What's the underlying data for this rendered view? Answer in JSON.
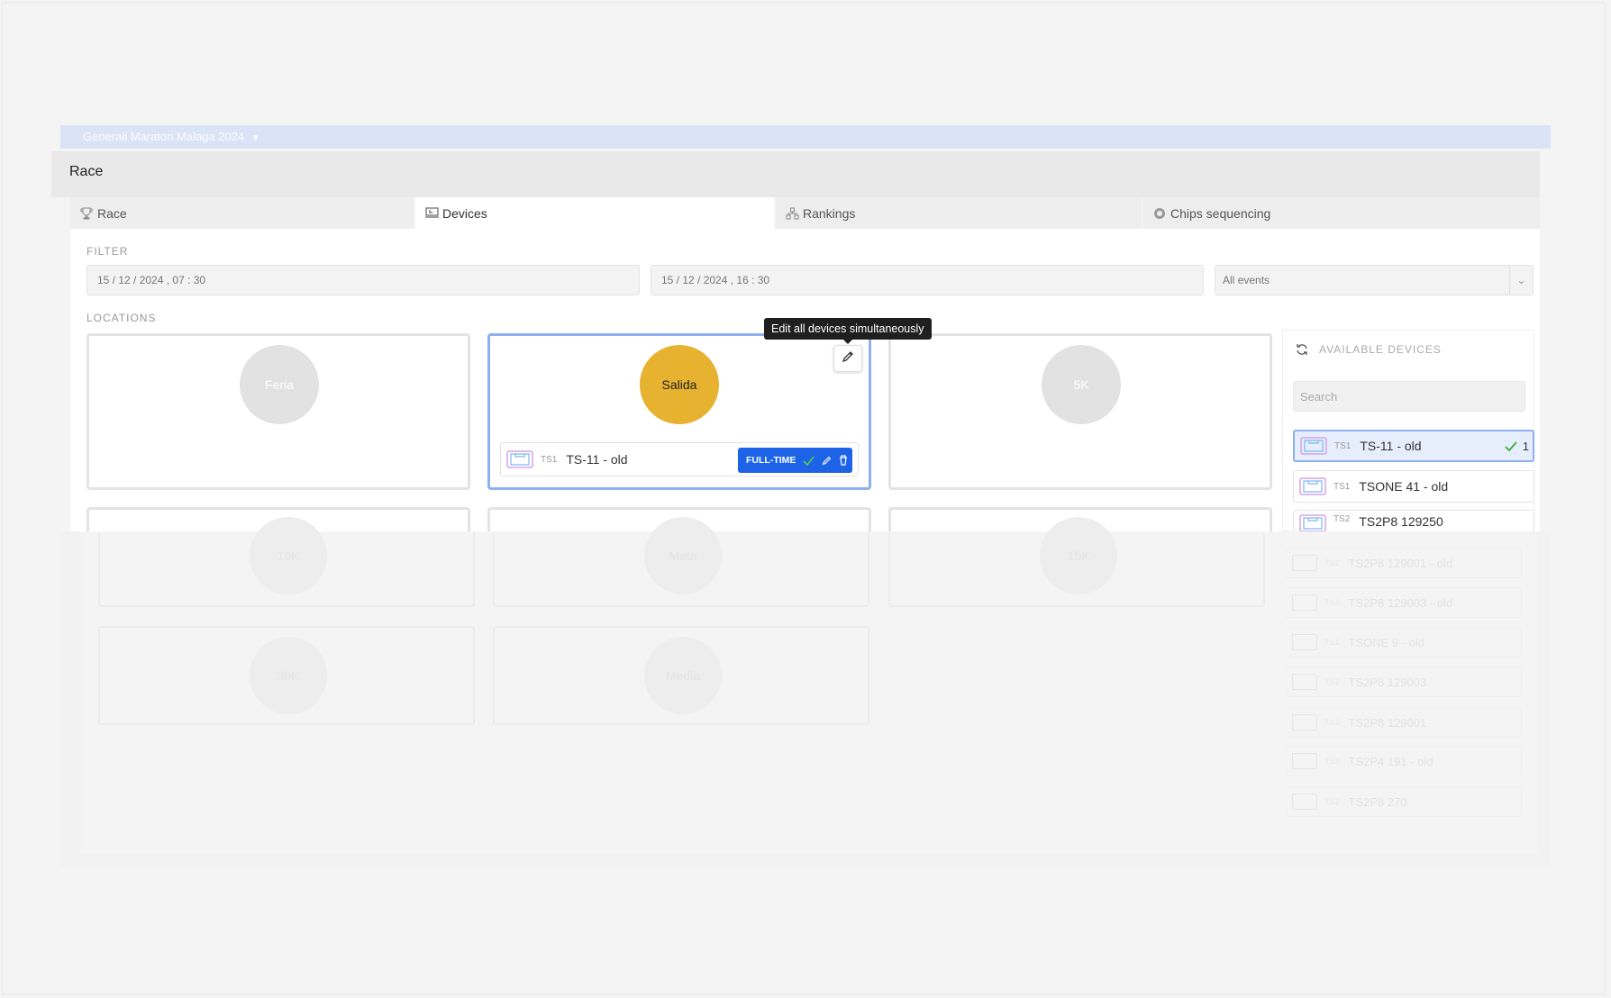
{
  "header": {
    "race_select": "Generali Maraton Malaga 2024",
    "panel_title": "Race"
  },
  "tabs": [
    {
      "label": "Race",
      "icon": "trophy-icon"
    },
    {
      "label": "Devices",
      "icon": "devices-icon",
      "active": true
    },
    {
      "label": "Rankings",
      "icon": "hierarchy-icon"
    },
    {
      "label": "Chips sequencing",
      "icon": "chip-icon"
    }
  ],
  "filter": {
    "label": "FILTER",
    "start": "15 / 12 / 2024 ,  07 : 30",
    "end": "15 / 12 / 2024 ,  16 : 30",
    "events": "All events"
  },
  "locations": {
    "label": "LOCATIONS",
    "items": [
      {
        "name": "Feria"
      },
      {
        "name": "Salida",
        "active": true,
        "device": {
          "code": "TS1",
          "name": "TS-11 - old",
          "mode": "FULL-TIME"
        }
      },
      {
        "name": "5K"
      }
    ],
    "faded": [
      "10K",
      "Meta",
      "15K",
      "30K",
      "Media"
    ],
    "tooltip": "Edit all devices simultaneously"
  },
  "available": {
    "title": "AVAILABLE DEVICES",
    "search_placeholder": "Search",
    "items": [
      {
        "code": "TS1",
        "name": "TS-11 - old",
        "selected": true,
        "count": "1"
      },
      {
        "code": "TS1",
        "name": "TSONE 41 - old"
      },
      {
        "code": "TS2",
        "name": "TS2P8 129250"
      }
    ],
    "faded_items": [
      {
        "code": "TS2",
        "name": "TS2P8 129001 - old"
      },
      {
        "code": "TS2",
        "name": "TS2P8 129003 - old"
      },
      {
        "code": "TS1",
        "name": "TSONE 9 - old"
      },
      {
        "code": "TS2",
        "name": "TS2P8 129003"
      },
      {
        "code": "TS2",
        "name": "TS2P8 129001"
      },
      {
        "code": "TS2",
        "name": "TS2P4 191 - old"
      },
      {
        "code": "TS2",
        "name": "TS2P8 270"
      }
    ]
  },
  "colors": {
    "accent": "#1c63e8",
    "location_active": "#e6b22f",
    "selection_border": "#8fb0ef",
    "check": "#3aa935"
  }
}
